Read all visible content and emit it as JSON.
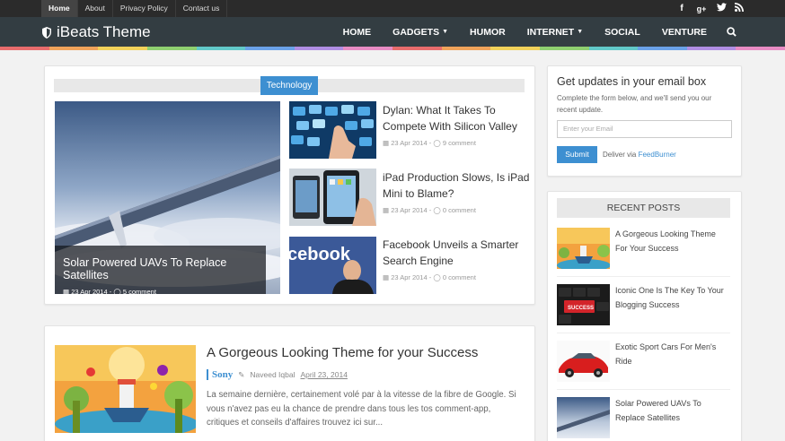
{
  "topbar": {
    "links": [
      "Home",
      "About",
      "Privacy Policy",
      "Contact us"
    ],
    "social": [
      "f",
      "g+",
      "t",
      "rss"
    ]
  },
  "header": {
    "site_title": "iBeats Theme",
    "nav": {
      "home": "HOME",
      "gadgets": "GADGETS",
      "humor": "HUMOR",
      "internet": "INTERNET",
      "social": "SOCIAL",
      "venture": "VENTURE"
    }
  },
  "colors": {
    "accent": "#3d8fd1",
    "stripes": [
      "#e86c6c",
      "#f0a35a",
      "#f2d25a",
      "#8fd070",
      "#62c9c9",
      "#6aa2e8",
      "#b08ee3",
      "#e88cc4",
      "#e86c6c",
      "#f0a35a",
      "#f2d25a",
      "#8fd070",
      "#62c9c9",
      "#6aa2e8",
      "#b08ee3",
      "#e88cc4"
    ]
  },
  "featured": {
    "category": "Technology",
    "main": {
      "title": "Solar Powered UAVs To Replace Satellites",
      "date": "23 Apr 2014",
      "comments": "5 comment"
    },
    "side": [
      {
        "title_line1": "Dylan: What It Takes To",
        "title_line2": "Compete With Silicon Valley",
        "date": "23 Apr 2014",
        "comments": "9 comment"
      },
      {
        "title_line1": "iPad Production Slows, Is iPad",
        "title_line2": "Mini to Blame?",
        "date": "23 Apr 2014",
        "comments": "0 comment"
      },
      {
        "title_line1": "Facebook Unveils a Smarter",
        "title_line2": "Search Engine",
        "date": "23 Apr 2014",
        "comments": "0 comment"
      }
    ],
    "facebook_image_text": "cebook"
  },
  "post": {
    "title": "A Gorgeous Looking Theme for your Success",
    "category": "Sony",
    "author": "Naveed Iqbal",
    "date": "April 23, 2014",
    "excerpt": "La semaine dernière, certainement volé par à la vitesse de la fibre de Google. Si vous n'avez pas eu la chance de prendre dans tous les tos comment-app, critiques et conseils d'affaires trouvez ici sur..."
  },
  "sidebar": {
    "subscribe": {
      "title": "Get updates in your email box",
      "description": "Complete the form below, and we'll send you our recent update.",
      "placeholder": "Enter your Email",
      "submit": "Submit",
      "deliver_prefix": "Deliver via",
      "deliver_link": "FeedBurner"
    },
    "recent": {
      "heading": "RECENT POSTS",
      "items": [
        {
          "line1": "A Gorgeous Looking Theme",
          "line2": "For Your Success"
        },
        {
          "line1": "Iconic One Is The Key To Your",
          "line2": "Blogging Success"
        },
        {
          "line1": "Exotic Sport Cars For Men's",
          "line2": "Ride"
        },
        {
          "line1": "Solar Powered UAVs To",
          "line2": "Replace Satellites"
        }
      ],
      "success_key_text": "SUCCESS"
    }
  }
}
